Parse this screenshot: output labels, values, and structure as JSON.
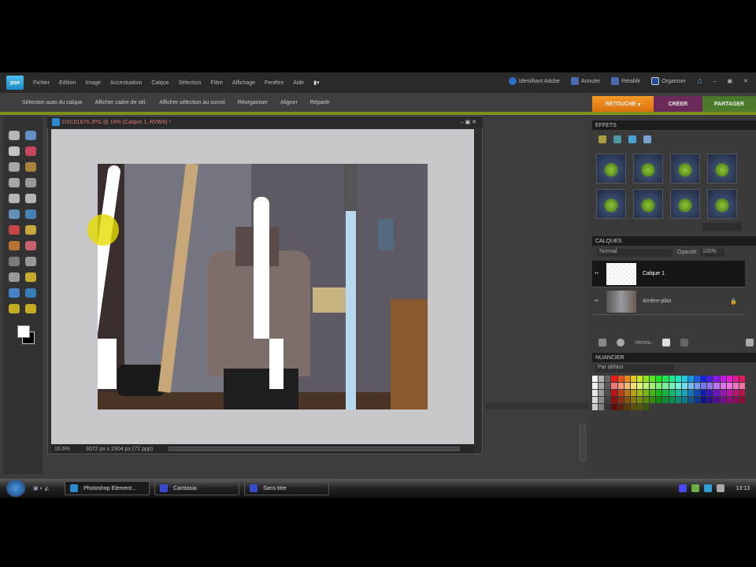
{
  "app": {
    "logo": "pse"
  },
  "menu": [
    "Fichier",
    "Edition",
    "Image",
    "Accentuation",
    "Calque",
    "Sélection",
    "Filtre",
    "Affichage",
    "Fenêtre",
    "Aide"
  ],
  "topright": {
    "create_account": "Identifiant Adobe",
    "undo": "Annuler",
    "redo": "Rétablir",
    "organizer": "Organiser"
  },
  "options": [
    "Sélection auto du calque",
    "Afficher cadre de sél.",
    "Afficher sélection au survol",
    "Réorganiser",
    "Aligner",
    "Répartir"
  ],
  "tabs": {
    "edit": "RETOUCHE",
    "create": "CRÉER",
    "share": "PARTAGER"
  },
  "document": {
    "title": "DSC01676.JPG @ 16% (Calque 1, RVB/8) *",
    "zoom": "16.6%",
    "info": "3072 px x 2304 px (72 ppp)"
  },
  "panels": {
    "effects": {
      "title": "EFFETS"
    },
    "layers": {
      "title": "CALQUES",
      "blend_mode": "Normal",
      "opacity_label": "Opacité:",
      "opacity": "100%",
      "lock_label": "Verrou :",
      "layers": [
        {
          "name": "Calque 1"
        },
        {
          "name": "Arrière-plan"
        }
      ]
    },
    "swatches": {
      "title": "NUANCIER",
      "set": "Par défaut"
    }
  },
  "taskbar": {
    "items": [
      "Photoshop Element...",
      "Camtasia",
      "Sans titre"
    ],
    "clock": "13:13"
  },
  "colors": {
    "edit_tab": "#e8820e",
    "create_tab": "#6b2a5a",
    "share_tab": "#4a7a2a",
    "accent_line": "#7d8f1c"
  }
}
